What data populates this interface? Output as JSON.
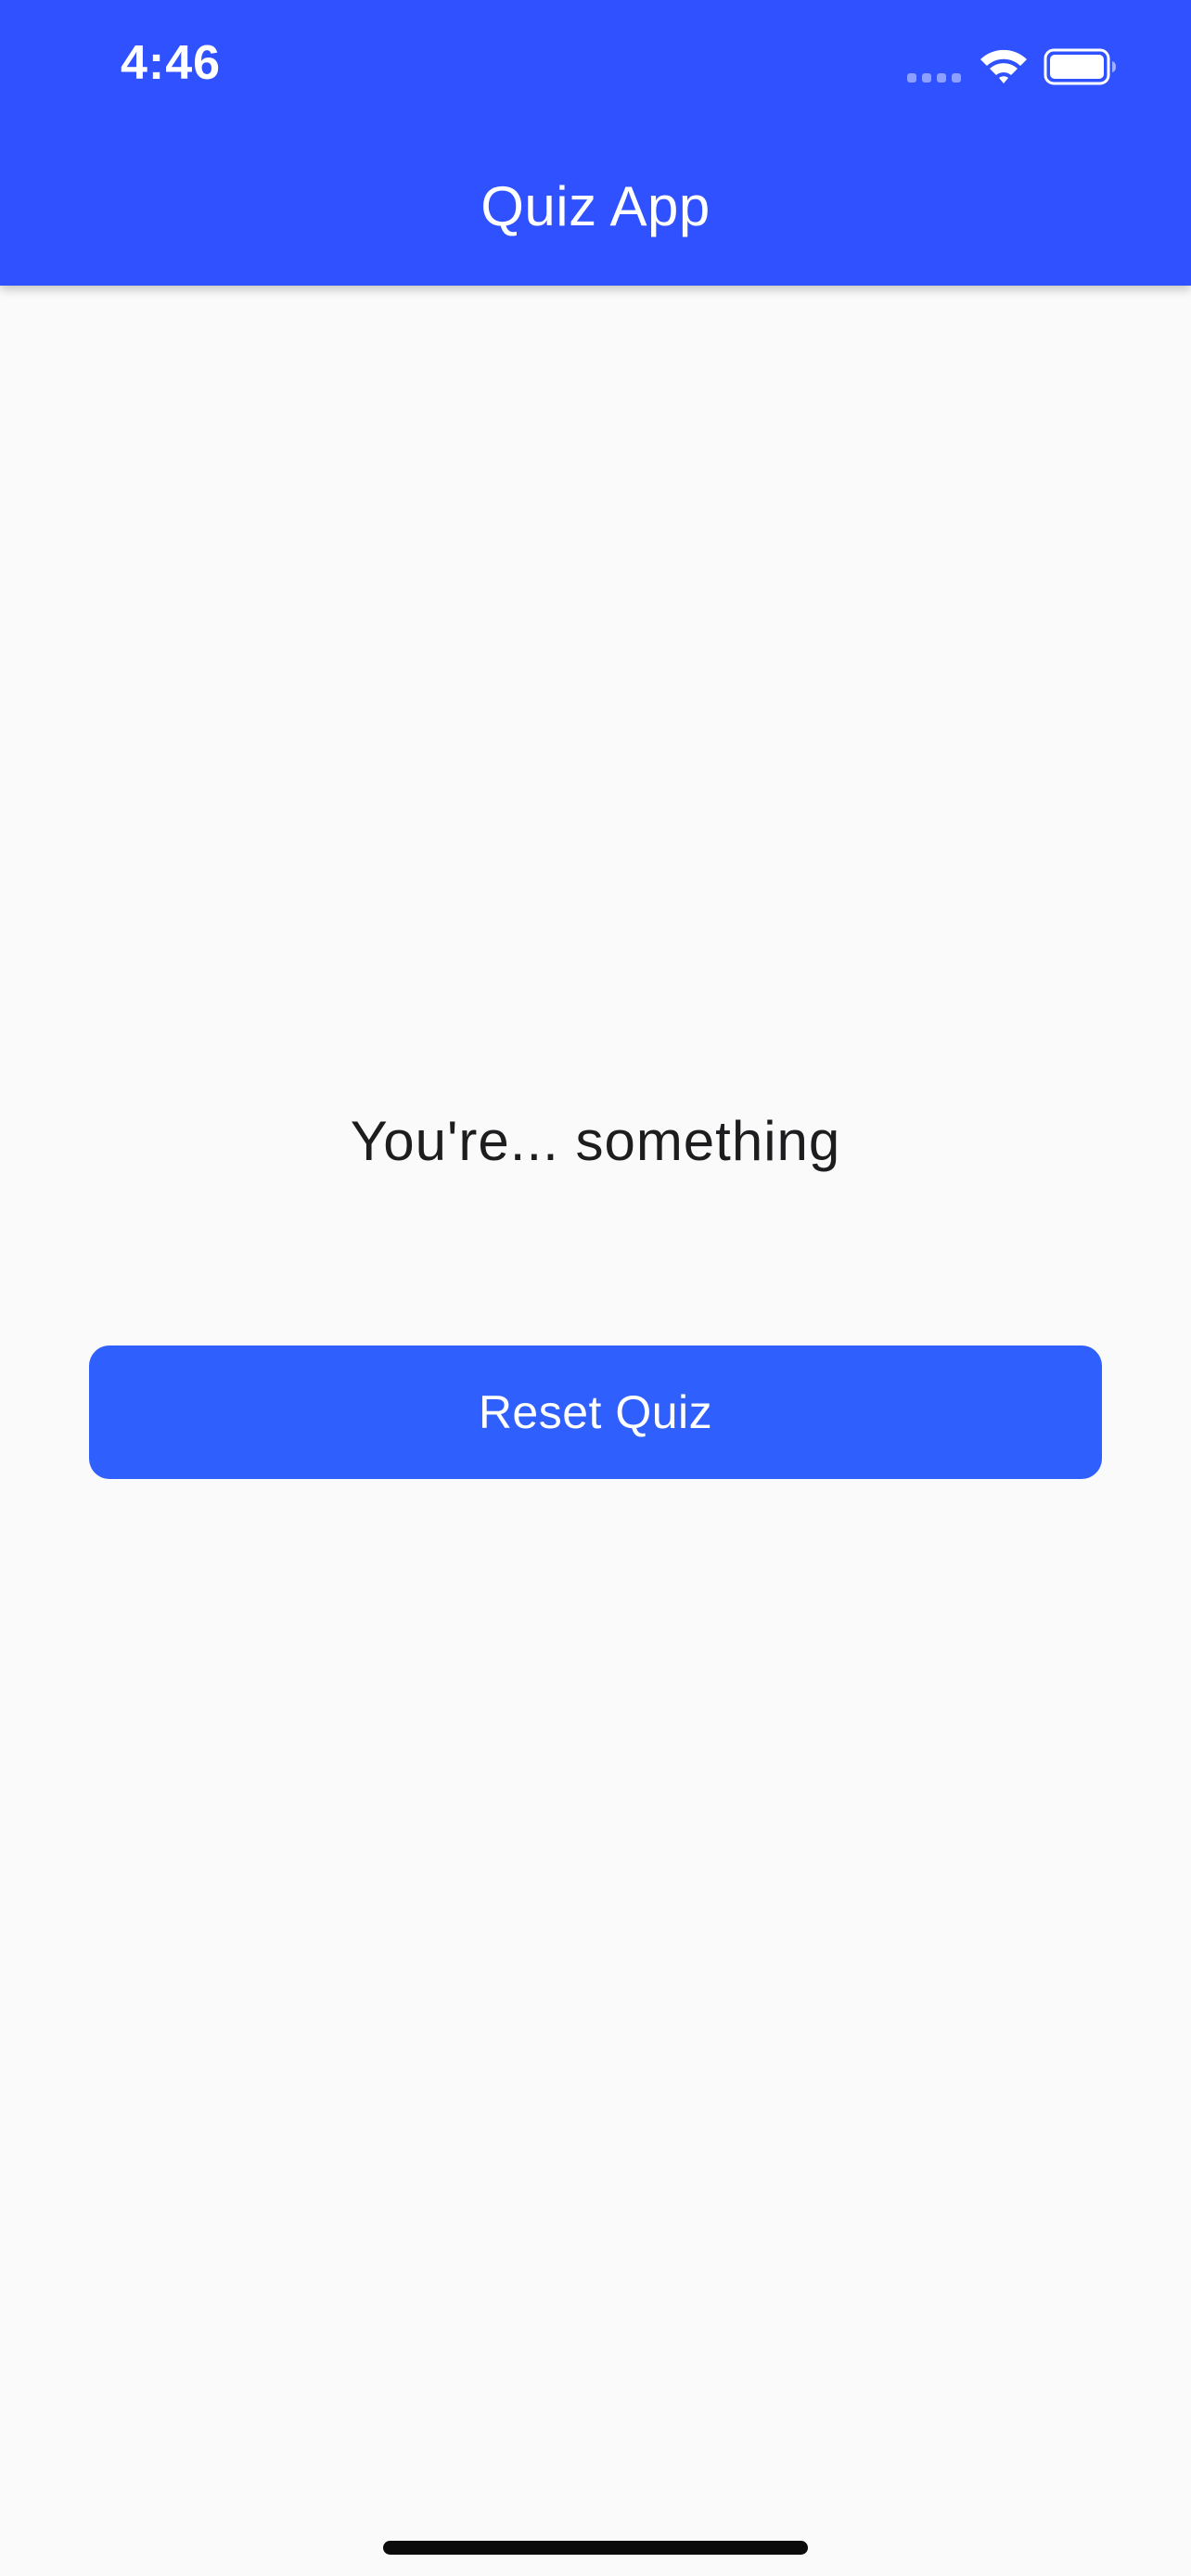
{
  "status_bar": {
    "time": "4:46",
    "signal_icon": "cellular-signal-dots-icon",
    "wifi_icon": "wifi-icon",
    "battery_icon": "battery-icon"
  },
  "app_bar": {
    "title": "Quiz App"
  },
  "main": {
    "result_text": "You're... something",
    "reset_label": "Reset Quiz"
  },
  "colors": {
    "app_bar_background": "#3051ff",
    "button_background": "#2f5ffc",
    "page_background": "#fafafa",
    "text": "#1d1d1f"
  }
}
